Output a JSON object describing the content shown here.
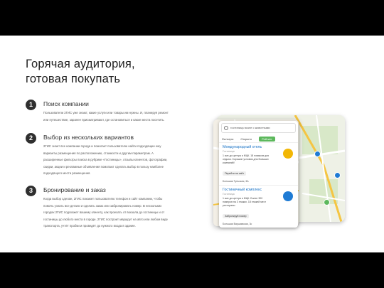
{
  "title": {
    "line1": "Горячая аудитория,",
    "line2": "готовая покупать"
  },
  "steps": [
    {
      "number": "1",
      "title": "Поиск компании",
      "text": "Пользователи 2ГИС уже знают, какие услуги или товары им нужны. И, планируя ремонт или путешествие, заранее присматривают, где остановиться и какие места посетить."
    },
    {
      "number": "2",
      "title": "Выбор из нескольких вариантов",
      "text": "2ГИС знает все компании города и помогает пользователю найти подходящие ему варианты размещения по расположению, стоимости и другим параметрам. А расширенные фильтры поиска в рубрике «Гостиницы», отзывы клиентов, фотографии, скидки, акции и рекламные объявления помогают сделать выбор в пользу наиболее подходящего места размещения."
    },
    {
      "number": "3",
      "title": "Бронирование и заказ",
      "text": "Когда выбор сделан, 2ГИС покажет пользователю телефон и сайт компании, чтобы помочь узнать все детали и сделать заказ или забронировать номер. В нескольких городах 2ГИС подскажет вашему клиенту, как проехать от вокзала до гостиницы и от гостиницы до любого места в городе. 2ГИС построит маршрут на авто или любом виде транспорта, учтёт пробки и проведёт до нужного входа в здание."
    }
  ],
  "phone": {
    "search_text": "гостиница возле с животными",
    "tabs": [
      "Фильтры",
      "Открыто",
      "Рейтинг"
    ],
    "items": [
      {
        "name": "Международный отель",
        "sub": "Гостиница",
        "desc": "1 кмх до центра и МЦК. 18 номеров для отдыха. Хорошие условия для больших компаний!",
        "button": "Перейти на сайт",
        "address": "Большая Тульская, 3А"
      },
      {
        "name": "Гостиничный комплекс",
        "sub": "Гостиница",
        "desc": "1 кмх до центра и МЦК. Более 300 номеров на 3 этажах. 18 этажей мест рестораны",
        "button": "Забронируй номер",
        "address": "Большая Варшавская, 3с"
      }
    ],
    "colors": {
      "accent_green": "#5cb85c",
      "brand_blue": "#1a73c6",
      "icon_yellow": "#f2b705",
      "icon_blue": "#1f7bd4"
    }
  }
}
